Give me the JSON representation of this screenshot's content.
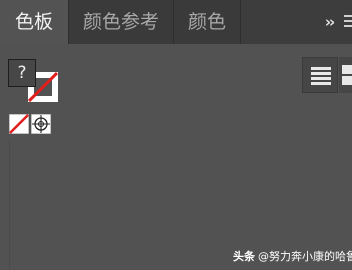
{
  "tabs": [
    {
      "label": "色板",
      "active": true
    },
    {
      "label": "颜色参考",
      "active": false
    },
    {
      "label": "颜色",
      "active": false
    }
  ],
  "tabbar": {
    "more_label": "››",
    "menu_icon": "panel-menu-icon"
  },
  "fill_stroke": {
    "fill_label": "?",
    "stroke_icon": "none-swatch-icon"
  },
  "view_buttons": {
    "list_icon": "list-view-icon",
    "grid_icon": "grid-view-icon"
  },
  "swatches": [
    {
      "name": "None",
      "icon": "none-swatch-icon"
    },
    {
      "name": "Registration",
      "icon": "registration-swatch-icon"
    }
  ],
  "watermark": {
    "brand": "头条",
    "author": "@努力奔小康的哈鲁噜"
  },
  "colors": {
    "panel_bg": "#525252",
    "tabbar_bg": "#3d3d3d",
    "none_red": "#e01e1e"
  }
}
